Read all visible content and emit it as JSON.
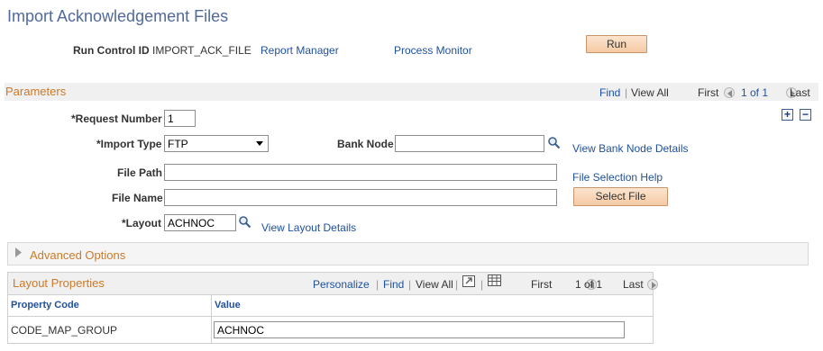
{
  "page": {
    "title": "Import Acknowledgement Files"
  },
  "run_control": {
    "label": "Run Control ID",
    "value": "IMPORT_ACK_FILE",
    "report_manager": "Report Manager",
    "process_monitor": "Process Monitor",
    "run_button": "Run"
  },
  "parameters": {
    "title": "Parameters",
    "nav": {
      "find": "Find",
      "sep": "|",
      "view_all": "View All",
      "first": "First",
      "count": "1 of 1",
      "last": "Last"
    },
    "request_number": {
      "label": "*Request Number",
      "value": "1"
    },
    "import_type": {
      "label": "*Import Type",
      "value": "FTP"
    },
    "bank_node": {
      "label": "Bank Node",
      "value": "",
      "link": "View Bank Node Details"
    },
    "file_path": {
      "label": "File Path",
      "value": "",
      "link": "File Selection Help"
    },
    "file_name": {
      "label": "File Name",
      "value": "",
      "button": "Select File"
    },
    "layout": {
      "label": "*Layout",
      "value": "ACHNOC",
      "link": "View Layout Details"
    },
    "add_symbol": "+",
    "remove_symbol": "−"
  },
  "advanced": {
    "label": "Advanced Options"
  },
  "layout_properties": {
    "title": "Layout Properties",
    "nav": {
      "personalize": "Personalize",
      "sep": "|",
      "find": "Find",
      "view_all": "View All",
      "first": "First",
      "count": "1 of 1",
      "last": "Last"
    },
    "columns": [
      "Property Code",
      "Value"
    ],
    "rows": [
      {
        "code": "CODE_MAP_GROUP",
        "value": "ACHNOC"
      }
    ]
  },
  "icons": {
    "lookup": "magnifier-icon",
    "prev": "prev-arrow-icon",
    "next": "next-arrow-icon",
    "zoom": "zoom-grid-icon",
    "download": "download-grid-icon",
    "expand": "triangle-right-icon"
  },
  "colors": {
    "title": "#516a9b",
    "link": "#20519f",
    "section": "#cc7a29",
    "button": "#f5caa4"
  }
}
